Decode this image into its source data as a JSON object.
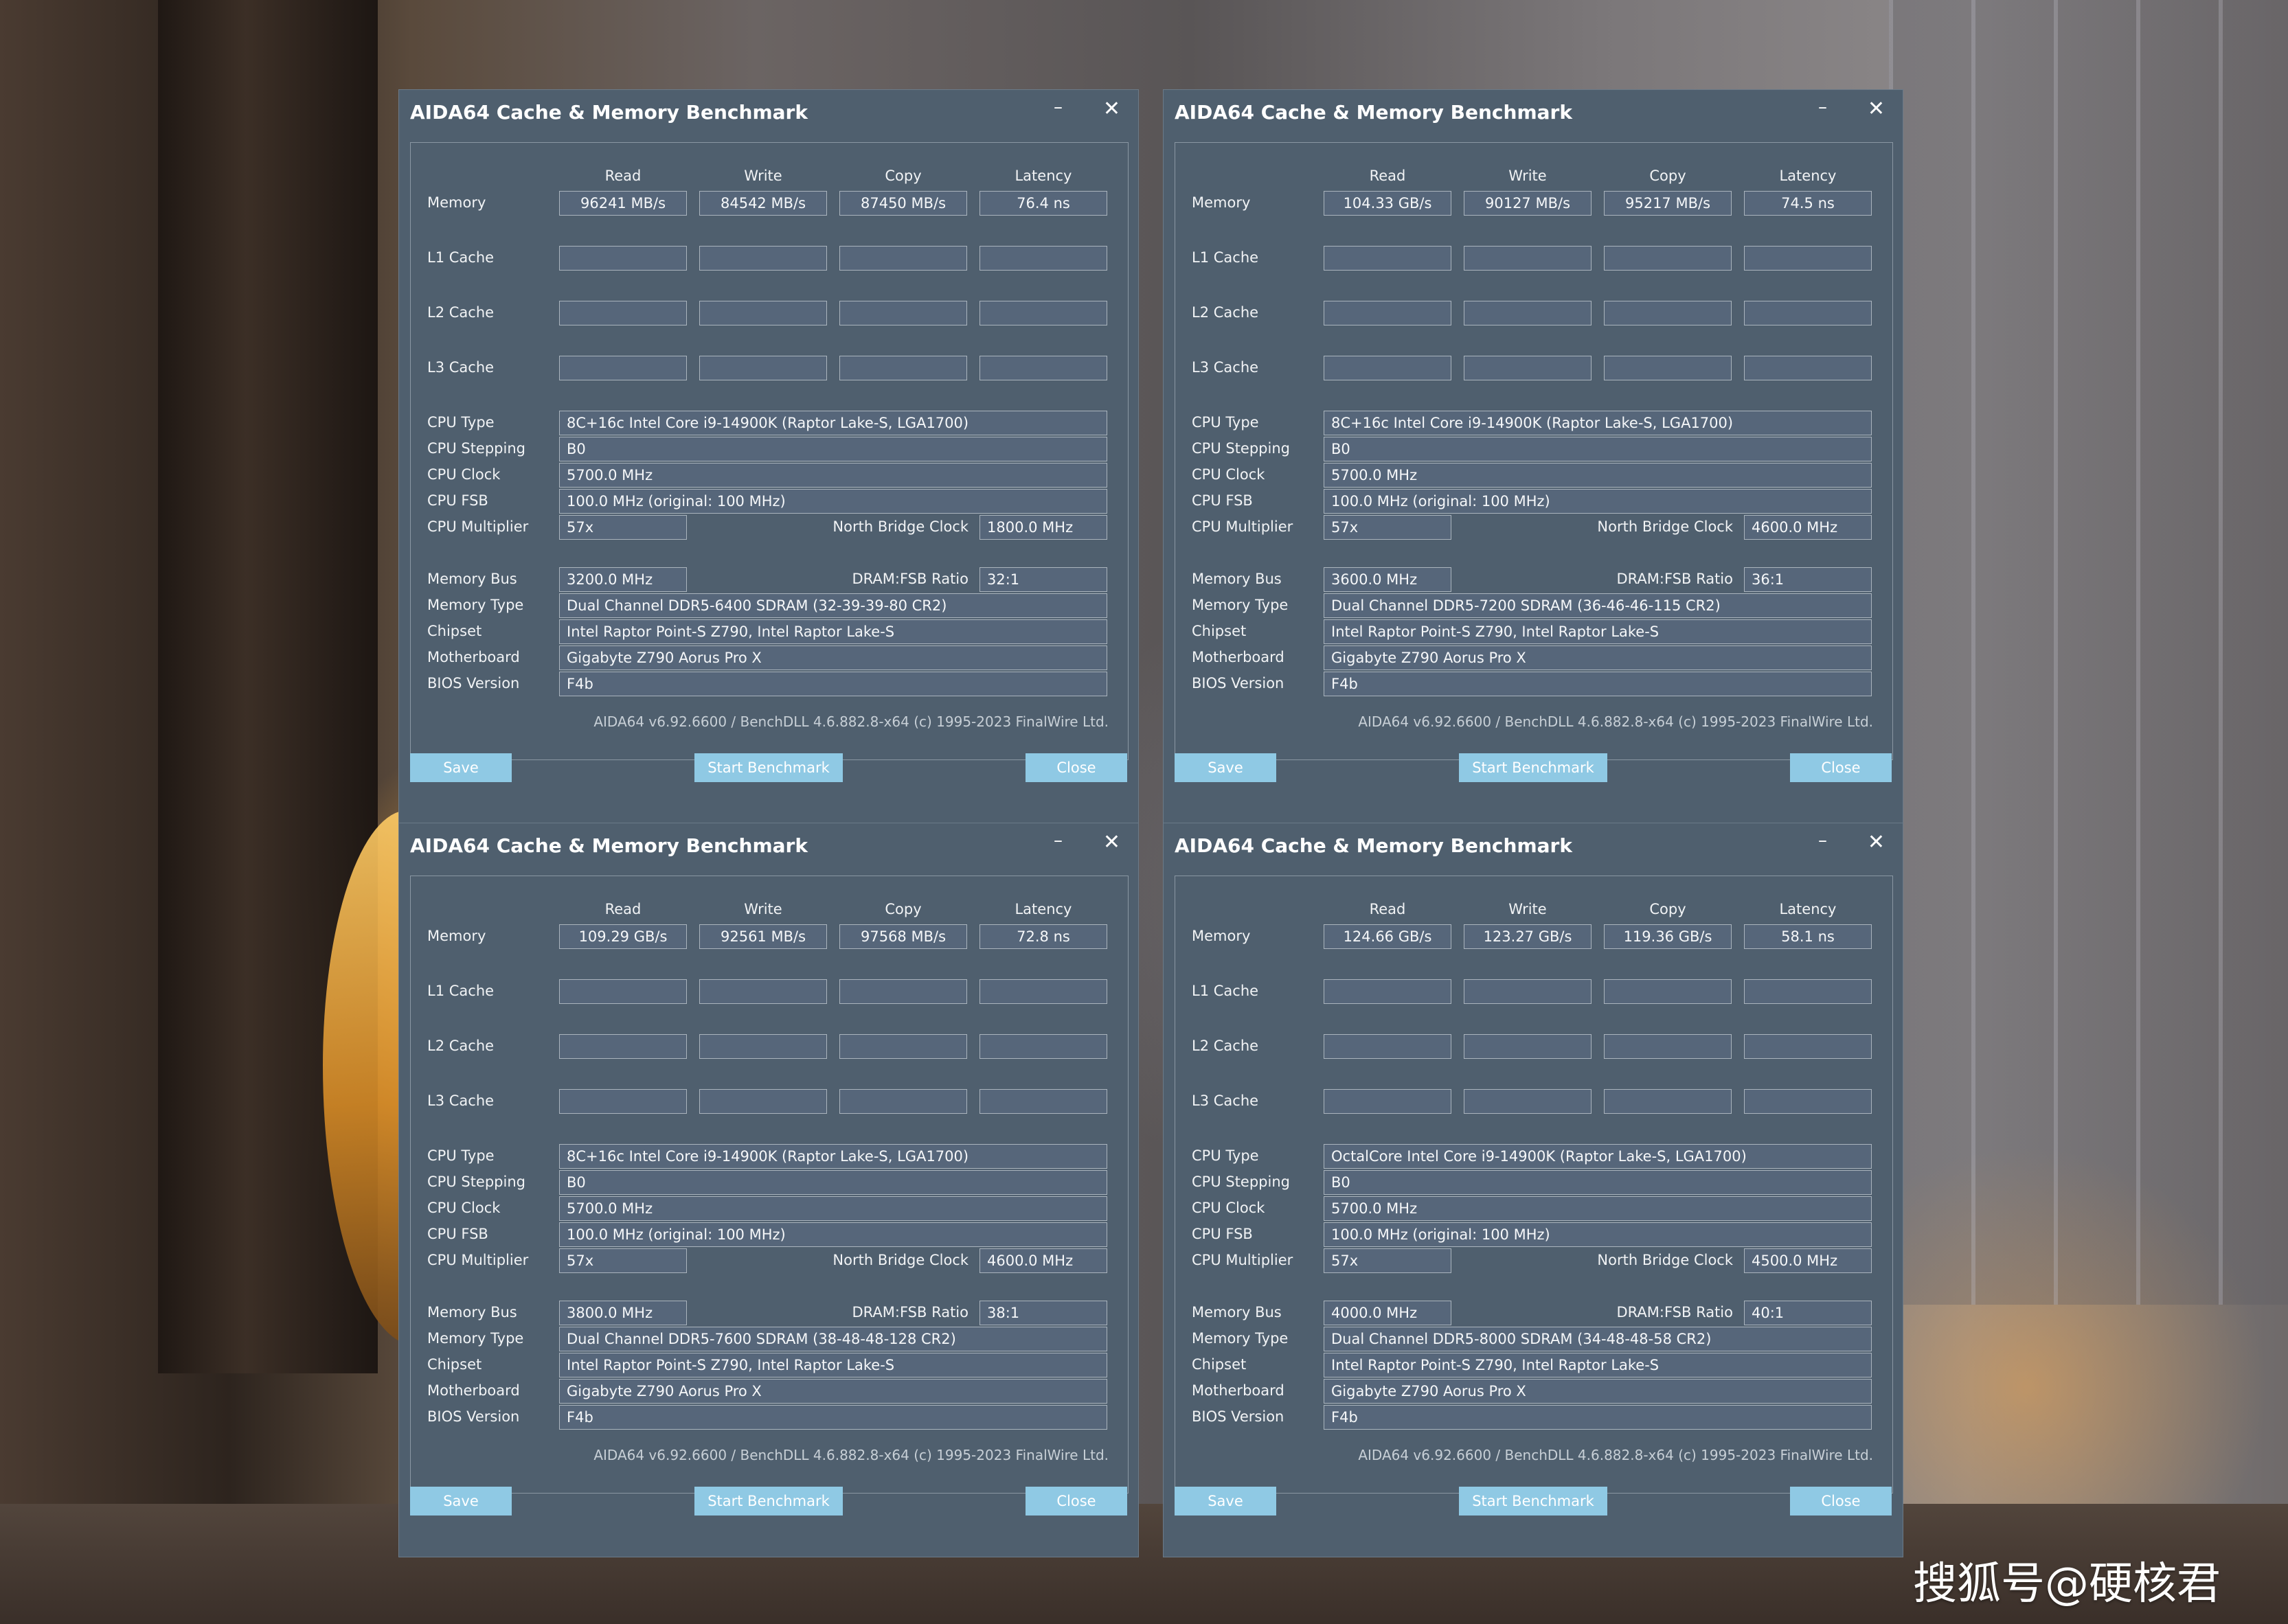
{
  "colors": {
    "window_bg": "#4f5f6e",
    "button_bg": "#8fc9e4",
    "field_bg": "#56667a"
  },
  "icons": {
    "minimize": "minimize-icon",
    "close": "close-icon"
  },
  "labels": {
    "title": "AIDA64 Cache & Memory Benchmark",
    "minimize": "–",
    "close": "✕",
    "col_read": "Read",
    "col_write": "Write",
    "col_copy": "Copy",
    "col_latency": "Latency",
    "memory": "Memory",
    "l1": "L1 Cache",
    "l2": "L2 Cache",
    "l3": "L3 Cache",
    "cpu_type": "CPU Type",
    "cpu_stepping": "CPU Stepping",
    "cpu_clock": "CPU Clock",
    "cpu_fsb": "CPU FSB",
    "cpu_multiplier": "CPU Multiplier",
    "north_bridge_clock": "North Bridge Clock",
    "memory_bus": "Memory Bus",
    "dram_fsb_ratio": "DRAM:FSB Ratio",
    "memory_type": "Memory Type",
    "chipset": "Chipset",
    "motherboard": "Motherboard",
    "bios_version": "BIOS Version",
    "footer": "AIDA64 v6.92.6600 / BenchDLL 4.6.882.8-x64  (c) 1995-2023 FinalWire Ltd.",
    "save": "Save",
    "start_benchmark": "Start Benchmark",
    "close_button": "Close"
  },
  "windows": [
    {
      "memory": {
        "read": "96241 MB/s",
        "write": "84542 MB/s",
        "copy": "87450 MB/s",
        "latency": "76.4 ns"
      },
      "cpu_type": "8C+16c Intel Core i9-14900K  (Raptor Lake-S, LGA1700)",
      "cpu_stepping": "B0",
      "cpu_clock": "5700.0 MHz",
      "cpu_fsb": "100.0 MHz  (original: 100 MHz)",
      "cpu_multiplier": "57x",
      "north_bridge_clock": "1800.0 MHz",
      "memory_bus": "3200.0 MHz",
      "dram_fsb_ratio": "32:1",
      "memory_type": "Dual Channel DDR5-6400 SDRAM  (32-39-39-80 CR2)",
      "chipset": "Intel Raptor Point-S Z790, Intel Raptor Lake-S",
      "motherboard": "Gigabyte Z790 Aorus Pro X",
      "bios_version": "F4b"
    },
    {
      "memory": {
        "read": "104.33 GB/s",
        "write": "90127 MB/s",
        "copy": "95217 MB/s",
        "latency": "74.5 ns"
      },
      "cpu_type": "8C+16c Intel Core i9-14900K  (Raptor Lake-S, LGA1700)",
      "cpu_stepping": "B0",
      "cpu_clock": "5700.0 MHz",
      "cpu_fsb": "100.0 MHz  (original: 100 MHz)",
      "cpu_multiplier": "57x",
      "north_bridge_clock": "4600.0 MHz",
      "memory_bus": "3600.0 MHz",
      "dram_fsb_ratio": "36:1",
      "memory_type": "Dual Channel DDR5-7200 SDRAM  (36-46-46-115 CR2)",
      "chipset": "Intel Raptor Point-S Z790, Intel Raptor Lake-S",
      "motherboard": "Gigabyte Z790 Aorus Pro X",
      "bios_version": "F4b"
    },
    {
      "memory": {
        "read": "109.29 GB/s",
        "write": "92561 MB/s",
        "copy": "97568 MB/s",
        "latency": "72.8 ns"
      },
      "cpu_type": "8C+16c Intel Core i9-14900K  (Raptor Lake-S, LGA1700)",
      "cpu_stepping": "B0",
      "cpu_clock": "5700.0 MHz",
      "cpu_fsb": "100.0 MHz  (original: 100 MHz)",
      "cpu_multiplier": "57x",
      "north_bridge_clock": "4600.0 MHz",
      "memory_bus": "3800.0 MHz",
      "dram_fsb_ratio": "38:1",
      "memory_type": "Dual Channel DDR5-7600 SDRAM  (38-48-48-128 CR2)",
      "chipset": "Intel Raptor Point-S Z790, Intel Raptor Lake-S",
      "motherboard": "Gigabyte Z790 Aorus Pro X",
      "bios_version": "F4b"
    },
    {
      "memory": {
        "read": "124.66 GB/s",
        "write": "123.27 GB/s",
        "copy": "119.36 GB/s",
        "latency": "58.1 ns"
      },
      "cpu_type": "OctalCore Intel Core i9-14900K  (Raptor Lake-S, LGA1700)",
      "cpu_stepping": "B0",
      "cpu_clock": "5700.0 MHz",
      "cpu_fsb": "100.0 MHz  (original: 100 MHz)",
      "cpu_multiplier": "57x",
      "north_bridge_clock": "4500.0 MHz",
      "memory_bus": "4000.0 MHz",
      "dram_fsb_ratio": "40:1",
      "memory_type": "Dual Channel DDR5-8000 SDRAM  (34-48-48-58 CR2)",
      "chipset": "Intel Raptor Point-S Z790, Intel Raptor Lake-S",
      "motherboard": "Gigabyte Z790 Aorus Pro X",
      "bios_version": "F4b"
    }
  ],
  "watermark": "搜狐号@硬核君"
}
